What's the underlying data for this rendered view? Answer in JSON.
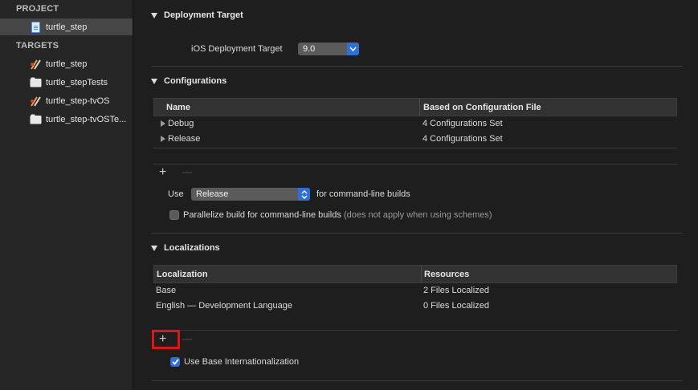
{
  "sidebar": {
    "project_header": "PROJECT",
    "project_item": "turtle_step",
    "targets_header": "TARGETS",
    "targets": [
      {
        "label": "turtle_step",
        "icon": "app-target-icon"
      },
      {
        "label": "turtle_stepTests",
        "icon": "test-bundle-icon"
      },
      {
        "label": "turtle_step-tvOS",
        "icon": "app-target-icon"
      },
      {
        "label": "turtle_step-tvOSTe...",
        "icon": "test-bundle-icon"
      }
    ]
  },
  "deployment": {
    "title": "Deployment Target",
    "label": "iOS Deployment Target",
    "value": "9.0"
  },
  "configurations": {
    "title": "Configurations",
    "columns": [
      "Name",
      "Based on Configuration File"
    ],
    "rows": [
      {
        "name": "Debug",
        "file": "4 Configurations Set"
      },
      {
        "name": "Release",
        "file": "4 Configurations Set"
      }
    ],
    "plus": "+",
    "minus": "—",
    "use_label": "Use",
    "use_value": "Release",
    "use_suffix": "for command-line builds",
    "parallelize_label": "Parallelize build for command-line builds",
    "parallelize_note": "(does not apply when using schemes)"
  },
  "localizations": {
    "title": "Localizations",
    "columns": [
      "Localization",
      "Resources"
    ],
    "rows": [
      {
        "name": "Base",
        "res": "2 Files Localized"
      },
      {
        "name": "English — Development Language",
        "res": "0 Files Localized"
      }
    ],
    "plus": "+",
    "minus": "—",
    "use_base_label": "Use Base Internationalization"
  },
  "colors": {
    "accent": "#2f6fd6",
    "highlight": "#e0141b"
  }
}
